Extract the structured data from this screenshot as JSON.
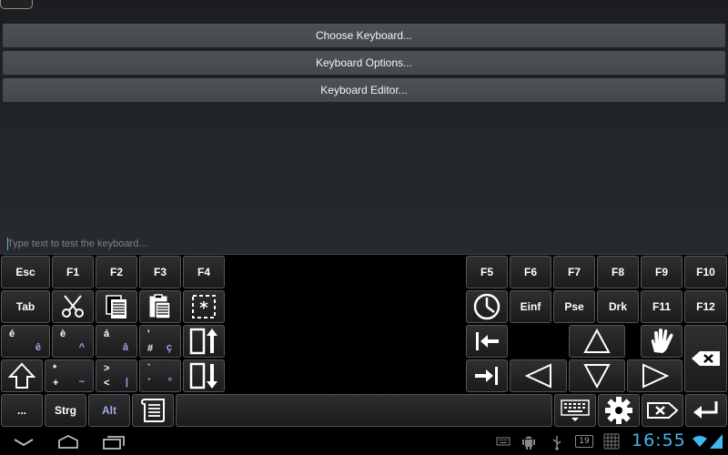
{
  "menu": {
    "choose_keyboard": "Choose Keyboard...",
    "keyboard_options": "Keyboard Options...",
    "keyboard_editor": "Keyboard Editor..."
  },
  "test_input": {
    "placeholder": "Type text to test the keyboard...",
    "value": ""
  },
  "keys": {
    "esc": "Esc",
    "f1": "F1",
    "f2": "F2",
    "f3": "F3",
    "f4": "F4",
    "f5": "F5",
    "f6": "F6",
    "f7": "F7",
    "f8": "F8",
    "f9": "F9",
    "f10": "F10",
    "f11": "F11",
    "f12": "F12",
    "tab": "Tab",
    "einf": "Einf",
    "pse": "Pse",
    "drk": "Drk",
    "e_acute": "é",
    "e_circ": "ê",
    "e_grave": "è",
    "caret": "^",
    "a_acute": "á",
    "a_circ": "â",
    "apostrophe": "'",
    "hash": "#",
    "c_cedil": "ç",
    "star": "*",
    "plus": "+",
    "tilde": "~",
    "gt": ">",
    "lt": "<",
    "pipe": "|",
    "backtick": "`",
    "acute": "´",
    "degree": "°",
    "more": "...",
    "strg": "Strg",
    "alt": "Alt"
  },
  "status_bar": {
    "notification_count": "19",
    "time": "16:55"
  },
  "colors": {
    "accent_blue": "#41b8ee",
    "secondary_char": "#a9a4f0"
  }
}
